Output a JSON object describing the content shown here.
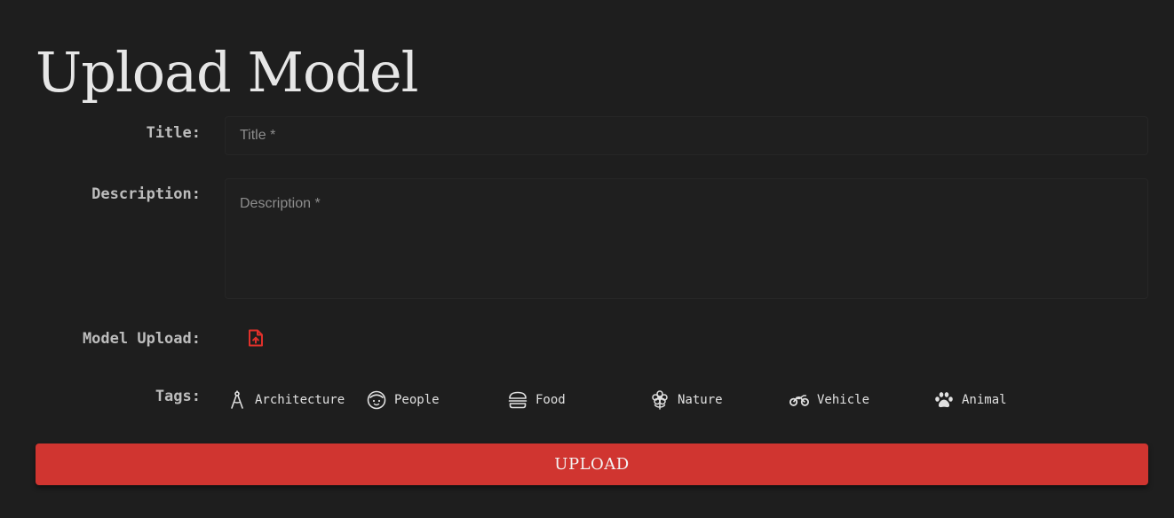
{
  "page": {
    "title": "Upload Model"
  },
  "form": {
    "title_label": "Title:",
    "title_placeholder": "Title *",
    "title_value": "",
    "description_label": "Description:",
    "description_placeholder": "Description *",
    "description_value": "",
    "model_upload_label": "Model Upload:",
    "model_upload_icon": "file-upload-icon",
    "tags_label": "Tags:",
    "tags": [
      {
        "label": "Architecture",
        "icon": "compass-icon"
      },
      {
        "label": "People",
        "icon": "face-icon"
      },
      {
        "label": "Food",
        "icon": "burger-icon"
      },
      {
        "label": "Nature",
        "icon": "flower-icon"
      },
      {
        "label": "Vehicle",
        "icon": "motorcycle-icon"
      },
      {
        "label": "Animal",
        "icon": "paw-icon"
      }
    ],
    "submit_label": "UPLOAD"
  },
  "colors": {
    "background": "#1e1e1e",
    "accent": "#d03530",
    "label_text": "#bdbdbd",
    "input_background": "#1f1f1f"
  }
}
